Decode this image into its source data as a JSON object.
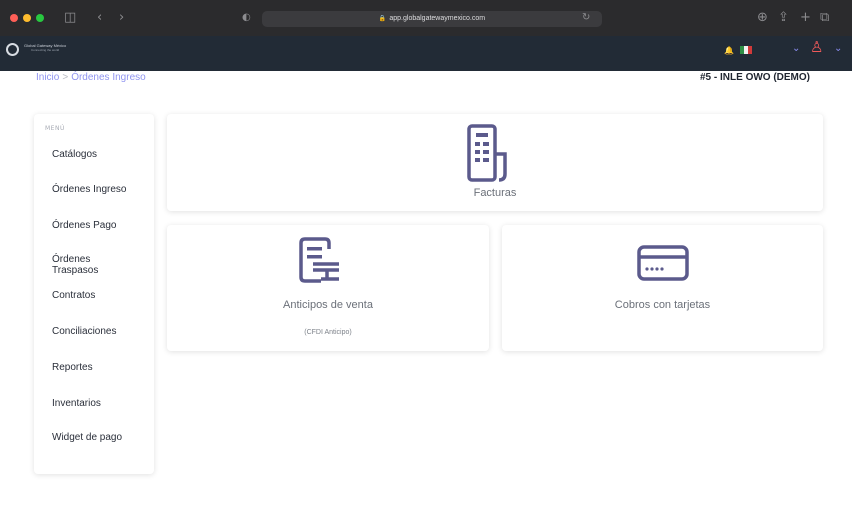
{
  "browser": {
    "url": "app.globalgatewaymexico.com",
    "icons": [
      "sidebar-icon",
      "back-icon",
      "forward-icon",
      "shield-icon",
      "reload-icon",
      "download-icon",
      "share-icon",
      "new-tab-icon",
      "tabs-icon"
    ]
  },
  "app_bar": {
    "logo_text": "Global Gateway México",
    "logo_sub": "Connecting the world",
    "lang_text": "",
    "colors": {
      "bar": "#222b36",
      "user": "#ef5a5a",
      "accent": "#8a8cf0"
    }
  },
  "breadcrumb": {
    "home": "Inicio",
    "separator": ">",
    "current": "Órdenes Ingreso"
  },
  "company": "#5 - INLE OWO (DEMO)",
  "sidebar": {
    "heading": "MENÚ",
    "items": [
      {
        "label": "Catálogos"
      },
      {
        "label": "Órdenes Ingreso"
      },
      {
        "label": "Órdenes Pago"
      },
      {
        "label": "Órdenes Traspasos"
      },
      {
        "label": "Contratos"
      },
      {
        "label": "Conciliaciones"
      },
      {
        "label": "Reportes"
      },
      {
        "label": "Inventarios"
      },
      {
        "label": "Widget de pago"
      }
    ]
  },
  "cards": [
    {
      "label": "Facturas",
      "icon": "invoice-icon"
    },
    {
      "label": "Anticipos de venta",
      "sub": "(CFDI Anticipo)",
      "icon": "advance-receipt-icon"
    },
    {
      "label": "Cobros con tarjetas",
      "icon": "credit-card-icon"
    }
  ],
  "colors": {
    "icon_stroke": "#5b5a8c",
    "breadcrumb": "#8f94f0"
  }
}
